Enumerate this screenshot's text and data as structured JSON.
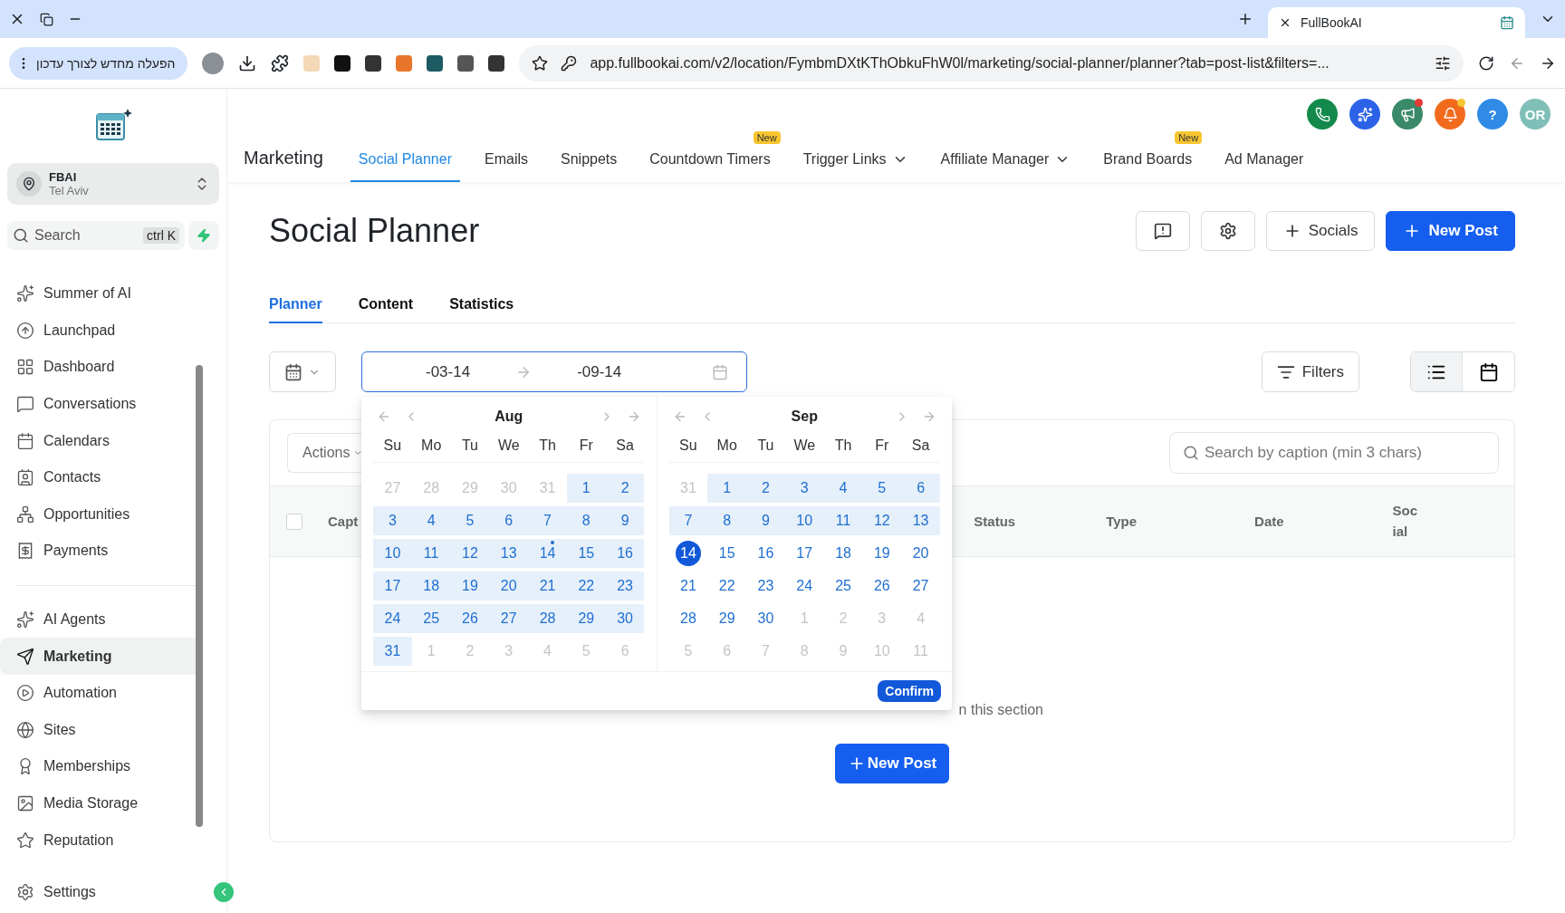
{
  "browser": {
    "tab_title": "FullBookAI",
    "update_button": "הפעלה מחדש לצורך עדכון",
    "url": "app.fullbookai.com/v2/location/FymbmDXtKThObkuFhW0l/marketing/social-planner/planner?tab=post-list&filters=..."
  },
  "sidebar": {
    "account": {
      "name": "FBAI",
      "location": "Tel Aviv"
    },
    "search": {
      "placeholder": "Search",
      "shortcut": "ctrl K"
    },
    "groups": [
      [
        {
          "label": "Summer of AI",
          "kind": "sparkle",
          "selected": false
        },
        {
          "label": "Launchpad",
          "kind": "launch",
          "selected": false
        },
        {
          "label": "Dashboard",
          "kind": "dashboard",
          "selected": false
        },
        {
          "label": "Conversations",
          "kind": "chat",
          "selected": false
        },
        {
          "label": "Calendars",
          "kind": "calendar",
          "selected": false
        },
        {
          "label": "Contacts",
          "kind": "contacts",
          "selected": false
        },
        {
          "label": "Opportunities",
          "kind": "network",
          "selected": false
        },
        {
          "label": "Payments",
          "kind": "receipt",
          "selected": false
        }
      ],
      [
        {
          "label": "AI Agents",
          "kind": "sparkle",
          "selected": false
        },
        {
          "label": "Marketing",
          "kind": "send",
          "selected": true
        },
        {
          "label": "Automation",
          "kind": "play",
          "selected": false
        },
        {
          "label": "Sites",
          "kind": "site",
          "selected": false
        },
        {
          "label": "Memberships",
          "kind": "award",
          "selected": false
        },
        {
          "label": "Media Storage",
          "kind": "image",
          "selected": false
        },
        {
          "label": "Reputation",
          "kind": "star",
          "selected": false
        }
      ]
    ],
    "settings": "Settings"
  },
  "top_nav": {
    "section": "Marketing",
    "avatar": "OR",
    "help": "?",
    "tabs": [
      {
        "label": "Social Planner",
        "selected": true
      },
      {
        "label": "Emails",
        "selected": false
      },
      {
        "label": "Snippets",
        "selected": false
      },
      {
        "label": "Countdown Timers",
        "selected": false,
        "badge": "New"
      },
      {
        "label": "Trigger Links",
        "selected": false,
        "has_menu": true
      },
      {
        "label": "Affiliate Manager",
        "selected": false,
        "has_menu": true
      },
      {
        "label": "Brand Boards",
        "selected": false,
        "badge": "New"
      },
      {
        "label": "Ad Manager",
        "selected": false
      }
    ]
  },
  "page": {
    "title": "Social Planner",
    "buttons": [
      {
        "kind": "feedback"
      },
      {
        "kind": "settings"
      },
      {
        "kind": "secondary",
        "label": "Socials"
      },
      {
        "kind": "primary",
        "label": "New Post"
      }
    ]
  },
  "sub_tabs": [
    {
      "label": "Planner",
      "selected": true
    },
    {
      "label": "Content",
      "selected": false
    },
    {
      "label": "Statistics",
      "selected": false
    }
  ],
  "date_range": {
    "start": "-03-14",
    "end": "-09-14"
  },
  "date_picker": {
    "confirm": "Confirm",
    "months": [
      {
        "month": "Aug",
        "weekdays": [
          "Su",
          "Mo",
          "Tu",
          "We",
          "Th",
          "Fr",
          "Sa"
        ],
        "days": [
          {
            "label": "27",
            "kind": "outside"
          },
          {
            "label": "28",
            "kind": "outside"
          },
          {
            "label": "29",
            "kind": "outside"
          },
          {
            "label": "30",
            "kind": "outside"
          },
          {
            "label": "31",
            "kind": "outside"
          },
          {
            "label": "1",
            "kind": "range"
          },
          {
            "label": "2",
            "kind": "range"
          },
          {
            "label": "3",
            "kind": "range"
          },
          {
            "label": "4",
            "kind": "range"
          },
          {
            "label": "5",
            "kind": "range"
          },
          {
            "label": "6",
            "kind": "range"
          },
          {
            "label": "7",
            "kind": "range"
          },
          {
            "label": "8",
            "kind": "range"
          },
          {
            "label": "9",
            "kind": "range"
          },
          {
            "label": "10",
            "kind": "range"
          },
          {
            "label": "11",
            "kind": "range"
          },
          {
            "label": "12",
            "kind": "range"
          },
          {
            "label": "13",
            "kind": "range"
          },
          {
            "label": "14",
            "kind": "today"
          },
          {
            "label": "15",
            "kind": "range"
          },
          {
            "label": "16",
            "kind": "range"
          },
          {
            "label": "17",
            "kind": "range"
          },
          {
            "label": "18",
            "kind": "range"
          },
          {
            "label": "19",
            "kind": "range"
          },
          {
            "label": "20",
            "kind": "range"
          },
          {
            "label": "21",
            "kind": "range"
          },
          {
            "label": "22",
            "kind": "range"
          },
          {
            "label": "23",
            "kind": "range"
          },
          {
            "label": "24",
            "kind": "range"
          },
          {
            "label": "25",
            "kind": "range"
          },
          {
            "label": "26",
            "kind": "range"
          },
          {
            "label": "27",
            "kind": "range"
          },
          {
            "label": "28",
            "kind": "range"
          },
          {
            "label": "29",
            "kind": "range"
          },
          {
            "label": "30",
            "kind": "range"
          },
          {
            "label": "31",
            "kind": "range"
          },
          {
            "label": "1",
            "kind": "outside"
          },
          {
            "label": "2",
            "kind": "outside"
          },
          {
            "label": "3",
            "kind": "outside"
          },
          {
            "label": "4",
            "kind": "outside"
          },
          {
            "label": "5",
            "kind": "outside"
          },
          {
            "label": "6",
            "kind": "outside"
          }
        ]
      },
      {
        "month": "Sep",
        "weekdays": [
          "Su",
          "Mo",
          "Tu",
          "We",
          "Th",
          "Fr",
          "Sa"
        ],
        "days": [
          {
            "label": "31",
            "kind": "outside"
          },
          {
            "label": "1",
            "kind": "range"
          },
          {
            "label": "2",
            "kind": "range"
          },
          {
            "label": "3",
            "kind": "range"
          },
          {
            "label": "4",
            "kind": "range"
          },
          {
            "label": "5",
            "kind": "range"
          },
          {
            "label": "6",
            "kind": "range"
          },
          {
            "label": "7",
            "kind": "range"
          },
          {
            "label": "8",
            "kind": "range"
          },
          {
            "label": "9",
            "kind": "range"
          },
          {
            "label": "10",
            "kind": "range"
          },
          {
            "label": "11",
            "kind": "range"
          },
          {
            "label": "12",
            "kind": "range"
          },
          {
            "label": "13",
            "kind": "range"
          },
          {
            "label": "14",
            "kind": "end"
          },
          {
            "label": "15",
            "kind": "day"
          },
          {
            "label": "16",
            "kind": "day"
          },
          {
            "label": "17",
            "kind": "day"
          },
          {
            "label": "18",
            "kind": "day"
          },
          {
            "label": "19",
            "kind": "day"
          },
          {
            "label": "20",
            "kind": "day"
          },
          {
            "label": "21",
            "kind": "day"
          },
          {
            "label": "22",
            "kind": "day"
          },
          {
            "label": "23",
            "kind": "day"
          },
          {
            "label": "24",
            "kind": "day"
          },
          {
            "label": "25",
            "kind": "day"
          },
          {
            "label": "26",
            "kind": "day"
          },
          {
            "label": "27",
            "kind": "day"
          },
          {
            "label": "28",
            "kind": "day"
          },
          {
            "label": "29",
            "kind": "day"
          },
          {
            "label": "30",
            "kind": "day"
          },
          {
            "label": "1",
            "kind": "outside"
          },
          {
            "label": "2",
            "kind": "outside"
          },
          {
            "label": "3",
            "kind": "outside"
          },
          {
            "label": "4",
            "kind": "outside"
          },
          {
            "label": "5",
            "kind": "outside"
          },
          {
            "label": "6",
            "kind": "outside"
          },
          {
            "label": "7",
            "kind": "outside"
          },
          {
            "label": "8",
            "kind": "outside"
          },
          {
            "label": "9",
            "kind": "outside"
          },
          {
            "label": "10",
            "kind": "outside"
          },
          {
            "label": "11",
            "kind": "outside"
          }
        ]
      }
    ]
  },
  "toolbar": {
    "filters": "Filters",
    "views": [
      {
        "kind": "list",
        "selected": true
      },
      {
        "kind": "calendar",
        "selected": false
      }
    ]
  },
  "table": {
    "actions": "Actions",
    "select_all_checked": false,
    "search": {
      "placeholder": "Search by caption (min 3 chars)"
    },
    "columns": [
      "Capt",
      "Status",
      "Type",
      "Date",
      "Social"
    ],
    "empty_text": "n this section",
    "empty_button": "New Post"
  }
}
